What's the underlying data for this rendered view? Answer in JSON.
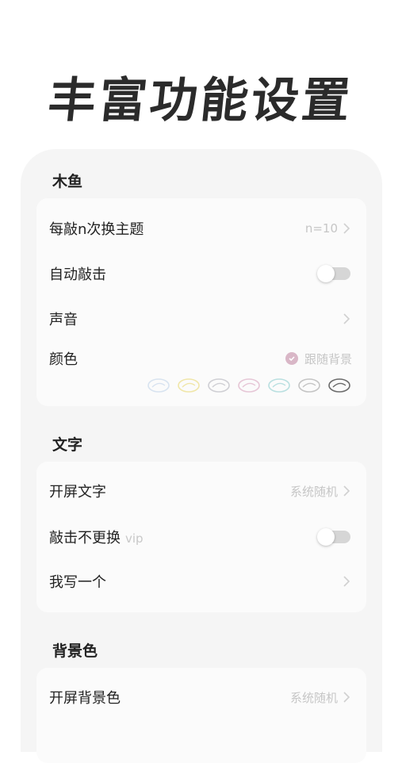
{
  "headline": "丰富功能设置",
  "sections": {
    "muyu": {
      "title": "木鱼",
      "theme_row": {
        "label": "每敲n次换主题",
        "value": "n=10"
      },
      "auto_row": {
        "label": "自动敲击"
      },
      "sound_row": {
        "label": "声音"
      },
      "color_row": {
        "label": "颜色",
        "value": "跟随背景"
      },
      "swatch_colors": [
        "#d8e3f0",
        "#f0e6a8",
        "#cfcfd4",
        "#e6c6d6",
        "#b9dfe0",
        "#c4c4c4",
        "#6a6a6a"
      ]
    },
    "text": {
      "title": "文字",
      "open_row": {
        "label": "开屏文字",
        "value": "系统随机"
      },
      "keep_row": {
        "label": "敲击不更换",
        "vip": "vip"
      },
      "write_row": {
        "label": "我写一个"
      }
    },
    "bg": {
      "title": "背景色",
      "open_row": {
        "label": "开屏背景色",
        "value": "系统随机"
      }
    }
  },
  "colors": {
    "page_bg": "#ffffff",
    "panel_bg": "#f5f5f5",
    "card_bg": "#fbfbfb",
    "muted_text": "#c6c6c6",
    "accent_pink": "#d9b7c7"
  },
  "icons": [
    "chevron-right-icon",
    "check-circle-icon",
    "fish-icon"
  ]
}
